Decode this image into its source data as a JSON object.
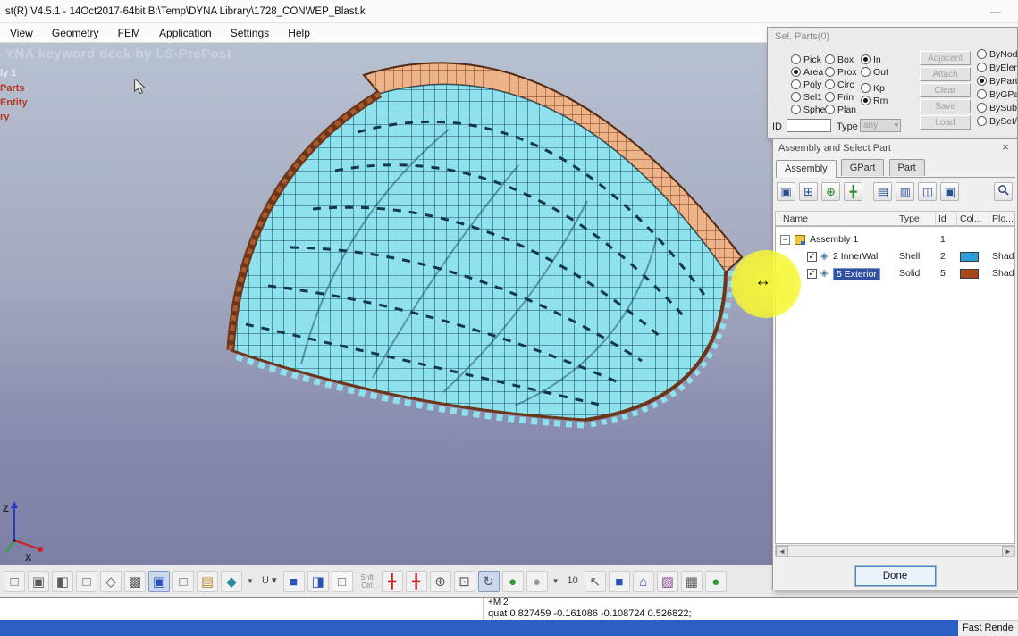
{
  "window": {
    "title": "st(R) V4.5.1 - 14Oct2017-64bit B:\\Temp\\DYNA Library\\1728_CONWEP_Blast.k",
    "minimize_glyph": "—"
  },
  "menubar": {
    "items": [
      "View",
      "Geometry",
      "FEM",
      "Application",
      "Settings",
      "Help"
    ]
  },
  "viewport": {
    "overlay_title": "YNA keyword deck by LS-PrePost",
    "left_labels": [
      "ly 1",
      "Parts",
      "Entity",
      "ry"
    ],
    "axis_z": "Z",
    "axis_x": "X",
    "cursor_glyph": "↔"
  },
  "sel_parts": {
    "title": "Sel. Parts(0)",
    "radios_col1": [
      "Pick",
      "Area",
      "Poly",
      "Sel1",
      "Sphe"
    ],
    "radios_col2": [
      "Box",
      "Prox",
      "Circ",
      "Frin",
      "Plan"
    ],
    "radios_col3": [
      "In",
      "Out",
      "Kp",
      "Rm"
    ],
    "selected_radios": [
      "Area",
      "In",
      "Rm",
      "ByPart"
    ],
    "buttons": [
      "Adjacent",
      "Attach",
      "Clear",
      "Save",
      "Load"
    ],
    "by_radios": [
      "ByNode",
      "ByElem",
      "ByPart",
      "ByGPart",
      "BySubsy",
      "BySet/Gr"
    ],
    "id_label": "ID",
    "id_value": "",
    "type_label": "Type",
    "type_value": "any",
    "dropdown_arrow": "▾"
  },
  "assembly_panel": {
    "title": "Assembly and Select Part",
    "close_glyph": "×",
    "tabs": [
      "Assembly",
      "GPart",
      "Part"
    ],
    "active_tab": "Assembly",
    "toolbar_icons": [
      "▣",
      "⊞",
      "⊕",
      "╋",
      "▤",
      "▥",
      "◫",
      "▣"
    ],
    "search_icon": "magnifier",
    "columns": [
      "Name",
      "Type",
      "Id",
      "Col...",
      "Plo..."
    ],
    "root_row": {
      "expander": "−",
      "name": "Assembly 1",
      "id": "1"
    },
    "rows": [
      {
        "check": "✓",
        "name": "2 InnerWall",
        "type": "Shell",
        "id": "2",
        "swatch_style": "background:#2e9fd6",
        "plot": "Shad"
      },
      {
        "check": "✓",
        "name": "5 Exterior",
        "type": "Solid",
        "id": "5",
        "swatch_style": "background:#a5491c",
        "plot": "Shad"
      }
    ],
    "scroll_left_glyph": "◄",
    "scroll_right_glyph": "►",
    "done_label": "Done"
  },
  "bottom_toolbar": {
    "icons": [
      "□",
      "▣",
      "◧",
      "□",
      "◇",
      "▩",
      "▣",
      "□",
      "▤",
      "◆",
      "▼",
      "U ▾",
      "■",
      "◨",
      "□",
      "╋",
      "╋",
      "⊕",
      "⊡",
      "↻",
      "●",
      "●",
      "▼",
      "↖",
      "■",
      "⌂",
      "▨",
      "▦",
      "●"
    ],
    "shift_label": "Shft",
    "ctrl_label": "Ctrl",
    "zoom_value": "10"
  },
  "status_bar": {
    "line1": "+M 2",
    "line2": "quat 0.827459 -0.161086 -0.108724 0.526822;",
    "render_mode": "Fast Rende"
  },
  "colors": {
    "part_innerwall": "#2e9fd6",
    "part_exterior": "#a5491c",
    "shell_mesh": "#8ee2ee",
    "solid_mesh": "#eeb489",
    "cursor_highlight": "#f6f634",
    "taskbar_blue": "#2a5fc4"
  }
}
